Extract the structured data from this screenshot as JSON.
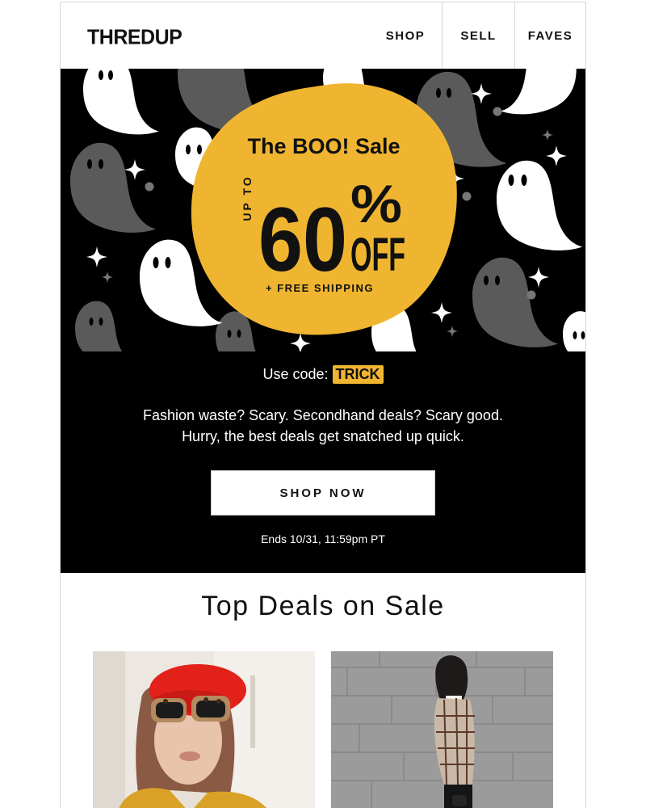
{
  "header": {
    "logo": "THREDUP",
    "nav": [
      {
        "label": "SHOP"
      },
      {
        "label": "SELL"
      },
      {
        "label": "FAVES"
      }
    ]
  },
  "hero": {
    "sale_title": "The BOO! Sale",
    "up_to": "UP TO",
    "discount": "60",
    "percent": "%",
    "off": "OFF",
    "shipping": "+ FREE SHIPPING",
    "code_prefix": "Use code:",
    "code": "TRICK",
    "tagline_1": "Fashion waste? Scary. Secondhand deals? Scary good.",
    "tagline_2": "Hurry, the best deals get snatched up quick.",
    "cta": "SHOP NOW",
    "ends": "Ends 10/31, 11:59pm PT",
    "colors": {
      "background": "#000000",
      "badge": "#f0b530",
      "ghost_light": "#ffffff",
      "ghost_dark": "#5a5a5a"
    }
  },
  "deals": {
    "title": "Top Deals on Sale"
  }
}
